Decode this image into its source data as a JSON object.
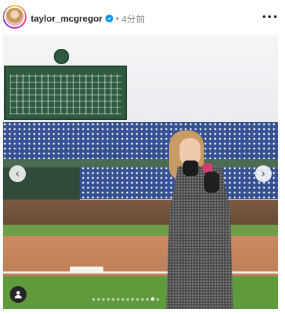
{
  "post": {
    "username": "taylor_mcgregor",
    "verified": true,
    "separator": "•",
    "time_ago": "4分前"
  },
  "icons": {
    "verified": "verified-badge-icon",
    "more": "more-options-icon",
    "prev": "chevron-left-icon",
    "next": "chevron-right-icon",
    "tag": "user-tag-icon"
  },
  "carousel": {
    "total_slides": 14,
    "active_index": 12,
    "prev_glyph": "‹",
    "next_glyph": "›"
  },
  "colors": {
    "verified_blue": "#0095f6",
    "text": "#262626",
    "muted": "#8e8e8e"
  }
}
